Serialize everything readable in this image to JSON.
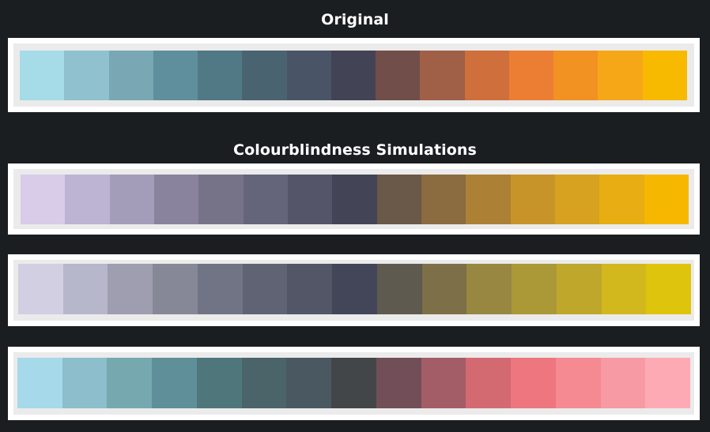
{
  "headings": {
    "original": "Original",
    "simulations": "Colourblindness Simulations"
  },
  "palettes": {
    "original": [
      "#a6dbe8",
      "#8fc1ce",
      "#79a8b4",
      "#5f8f9c",
      "#507885",
      "#4a6370",
      "#495566",
      "#434356",
      "#714e4a",
      "#a06048",
      "#cf6f3c",
      "#ec7e33",
      "#f29222",
      "#f5a718",
      "#f8ba00"
    ],
    "simulation_1": [
      "#d8cce9",
      "#bcb4d2",
      "#a49db9",
      "#8a839d",
      "#767389",
      "#64647a",
      "#555569",
      "#434556",
      "#6a5848",
      "#8b6b40",
      "#ac8136",
      "#c7942a",
      "#d6a21f",
      "#e7ad12",
      "#f6b700"
    ],
    "simulation_2": [
      "#d1cfe1",
      "#b7b7cb",
      "#9e9eb0",
      "#868797",
      "#717484",
      "#606374",
      "#525667",
      "#434658",
      "#5f5a50",
      "#7d7048",
      "#988741",
      "#ab9837",
      "#bfa72b",
      "#d2b81d",
      "#dfc40d"
    ],
    "simulation_3": [
      "#a6d9e9",
      "#8cbecb",
      "#76a8b0",
      "#5f8f99",
      "#4f777b",
      "#4b6469",
      "#4a5961",
      "#434649",
      "#724f58",
      "#a35d66",
      "#d46a71",
      "#ee767e",
      "#f58a93",
      "#f79aa4",
      "#feaab5"
    ]
  }
}
